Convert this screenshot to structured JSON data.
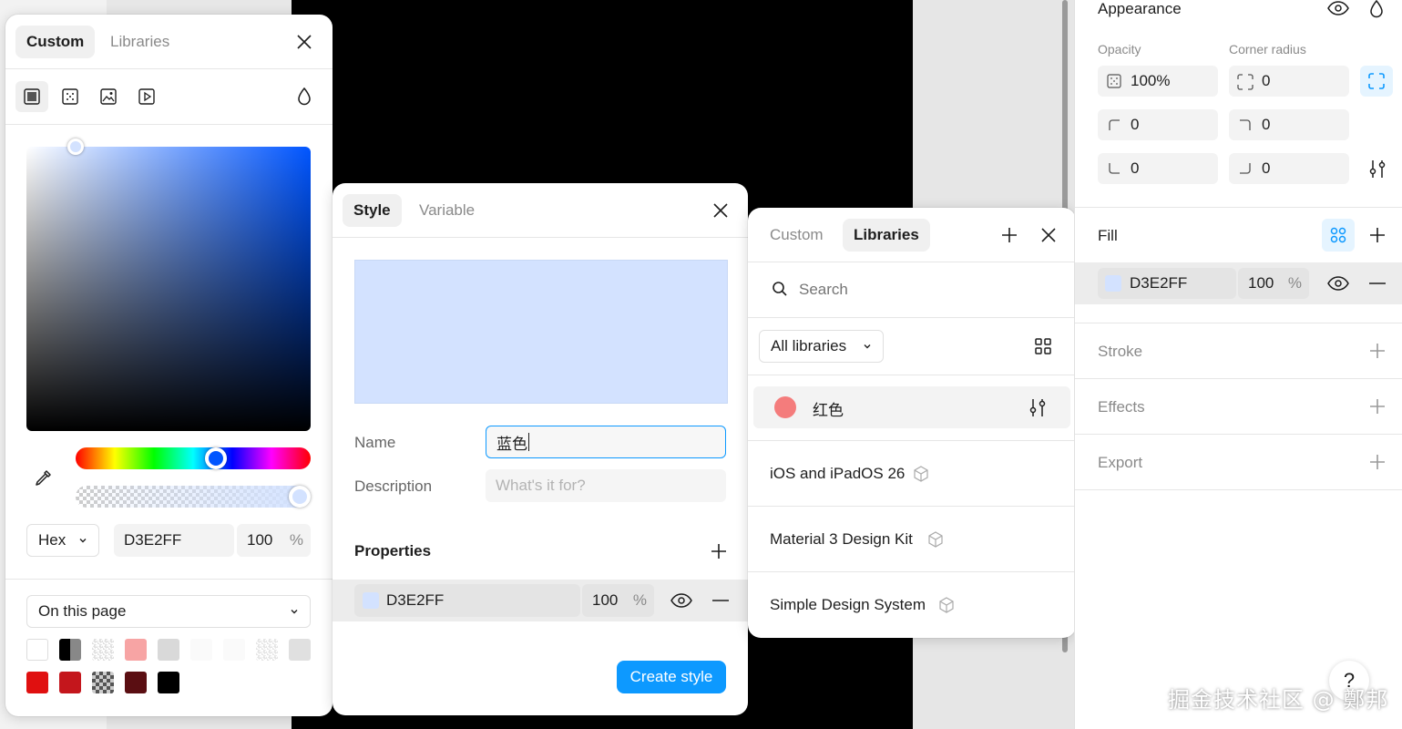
{
  "color_picker": {
    "tabs": [
      "Custom",
      "Libraries"
    ],
    "active_tab": "Custom",
    "format": "Hex",
    "hex": "D3E2FF",
    "opacity": "100",
    "percent": "%",
    "scope": "On this page",
    "hue_position": 0.6,
    "alpha_position": 1.0,
    "swatches_row1": [
      "#ffffff",
      "mixed-black",
      "checker",
      "#f7a4a4",
      "#d9d9d9",
      "blank",
      "blank",
      "checker",
      "#e0e0e0"
    ],
    "swatches_row2": [
      "#e01010",
      "#c4161c",
      "checker-dark",
      "#5a0e12",
      "#000000"
    ]
  },
  "create_style": {
    "tabs": [
      "Style",
      "Variable"
    ],
    "active_tab": "Style",
    "preview_color": "#D3E2FF",
    "name_label": "Name",
    "name_value": "蓝色",
    "description_label": "Description",
    "description_placeholder": "What's it for?",
    "properties_label": "Properties",
    "fill_hex": "D3E2FF",
    "fill_opacity": "100",
    "percent": "%",
    "create_button": "Create style"
  },
  "libraries": {
    "tabs": [
      "Custom",
      "Libraries"
    ],
    "active_tab": "Libraries",
    "search_placeholder": "Search",
    "filter": "All libraries",
    "style_item": {
      "name": "红色",
      "color": "#f47c7c"
    },
    "library_items": [
      "iOS and iPadOS 26",
      "Material 3 Design Kit",
      "Simple Design System"
    ]
  },
  "properties_panel": {
    "appearance_title": "Appearance",
    "opacity_label": "Opacity",
    "opacity_value": "100%",
    "corner_radius_label": "Corner radius",
    "corner_radius_value": "0",
    "corners": [
      "0",
      "0",
      "0",
      "0"
    ],
    "fill_title": "Fill",
    "fill_hex": "D3E2FF",
    "fill_opacity": "100",
    "percent": "%",
    "stroke_title": "Stroke",
    "effects_title": "Effects",
    "export_title": "Export",
    "help_label": "?"
  },
  "watermark": "掘金技术社区 @ 鄭邦",
  "colors": {
    "accent": "#0d99ff",
    "selected_fill": "#D3E2FF"
  }
}
